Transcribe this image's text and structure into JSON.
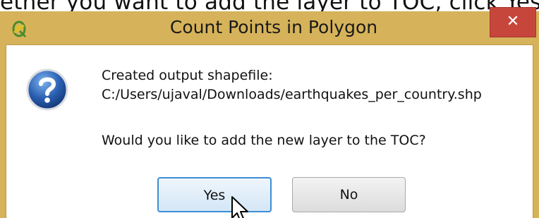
{
  "background": {
    "text": "ether you want to add the layer to TOC, click Yes"
  },
  "dialog": {
    "title": "Count Points in Polygon",
    "app_icon": "qgis-logo-icon",
    "close_icon": "close-icon",
    "close_glyph": "✕",
    "message_icon": "question-icon",
    "message_line1": "Created output shapefile:",
    "message_line2": "C:/Users/ujaval/Downloads/earthquakes_per_country.shp",
    "question": "Would you like to add the new layer to the TOC?",
    "buttons": {
      "yes": "Yes",
      "no": "No"
    },
    "cursor_icon": "arrow-cursor-icon"
  },
  "colors": {
    "frame": "#d6b35a",
    "close_button": "#c7463c",
    "default_button_border": "#3d8ed6",
    "question_icon": "#2a5fb0"
  }
}
